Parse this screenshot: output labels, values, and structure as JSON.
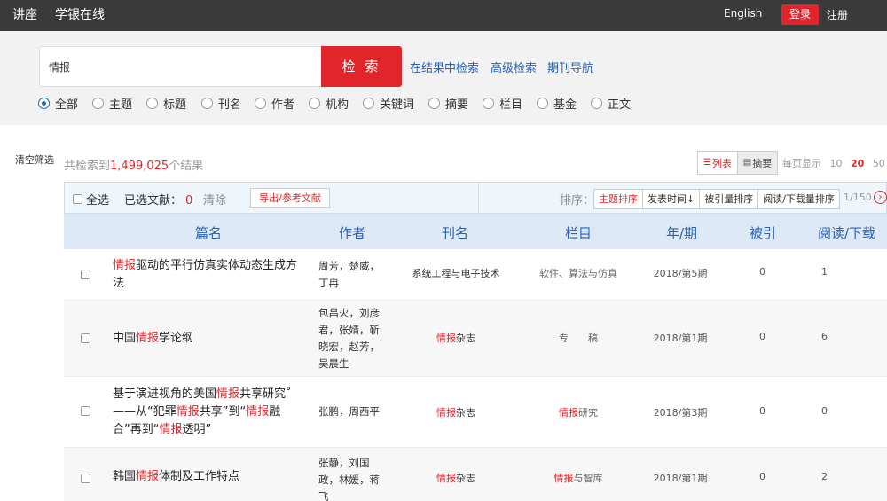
{
  "topbar": {
    "nav_left": [
      "讲座",
      "学银在线"
    ],
    "english": "English",
    "login": "登录",
    "register": "注册"
  },
  "search": {
    "query": "情报",
    "button": "检 索",
    "links": [
      "在结果中检索",
      "高级检索",
      "期刊导航"
    ],
    "scopes": [
      "全部",
      "主题",
      "标题",
      "刊名",
      "作者",
      "机构",
      "关键词",
      "摘要",
      "栏目",
      "基金",
      "正文"
    ],
    "selected_scope": "全部"
  },
  "results": {
    "clear_filter": "清空筛选",
    "total_prefix": "共检索到",
    "total_count": "1,499,025",
    "total_suffix": "个结果",
    "view_list": "列表",
    "view_abstract": "摘要",
    "per_page_label": "每页显示",
    "per_page_options": [
      "10",
      "20",
      "50"
    ],
    "per_page_selected": "20"
  },
  "toolbar": {
    "select_all": "全选",
    "selected_label": "已选文献：",
    "selected_count": "0",
    "clear": "清除",
    "export": "导出/参考文献",
    "sort_label": "排序：",
    "sort_options": [
      "主题排序",
      "发表时间↓",
      "被引量排序",
      "阅读/下载量排序"
    ],
    "pager": "1/150",
    "next_icon": "›"
  },
  "table": {
    "headers": [
      "篇名",
      "作者",
      "刊名",
      "栏目",
      "年/期",
      "被引",
      "阅读/下载"
    ],
    "rows": [
      {
        "title_parts": [
          [
            "情报",
            true
          ],
          [
            "驱动的平行仿真实体动态生成方法",
            false
          ]
        ],
        "authors": "周芳，楚威，丁冉",
        "journal_parts": [
          [
            "系统工程与电子技术",
            false
          ]
        ],
        "column_parts": [
          [
            "软件、算法与仿真",
            false
          ]
        ],
        "year_issue": "2018/第5期",
        "cited": "0",
        "reads": "1"
      },
      {
        "title_parts": [
          [
            "中国",
            false
          ],
          [
            "情报",
            true
          ],
          [
            "学论纲",
            false
          ]
        ],
        "authors": "包昌火，刘彦君，张婧，靳晓宏，赵芳，吴晨生",
        "journal_parts": [
          [
            "情报",
            true
          ],
          [
            "杂志",
            false
          ]
        ],
        "column_parts": [
          [
            "专　　稿",
            false
          ]
        ],
        "year_issue": "2018/第1期",
        "cited": "0",
        "reads": "6"
      },
      {
        "title_parts": [
          [
            "基于演进视角的美国",
            false
          ],
          [
            "情报",
            true
          ],
          [
            "共享研究˚——从“犯罪",
            false
          ],
          [
            "情报",
            true
          ],
          [
            "共享”到“",
            false
          ],
          [
            "情报",
            true
          ],
          [
            "融合”再到“",
            false
          ],
          [
            "情报",
            true
          ],
          [
            "透明”",
            false
          ]
        ],
        "authors": "张鹏，周西平",
        "journal_parts": [
          [
            "情报",
            true
          ],
          [
            "杂志",
            false
          ]
        ],
        "column_parts": [
          [
            "情报",
            true
          ],
          [
            "研究",
            false
          ]
        ],
        "year_issue": "2018/第3期",
        "cited": "0",
        "reads": "0"
      },
      {
        "title_parts": [
          [
            "韩国",
            false
          ],
          [
            "情报",
            true
          ],
          [
            "体制及工作特点",
            false
          ]
        ],
        "authors": "张静，刘国政，林媛，蒋飞",
        "journal_parts": [
          [
            "情报",
            true
          ],
          [
            "杂志",
            false
          ]
        ],
        "column_parts": [
          [
            "情报",
            true
          ],
          [
            "与智库",
            false
          ]
        ],
        "year_issue": "2018/第1期",
        "cited": "0",
        "reads": "2"
      }
    ]
  }
}
